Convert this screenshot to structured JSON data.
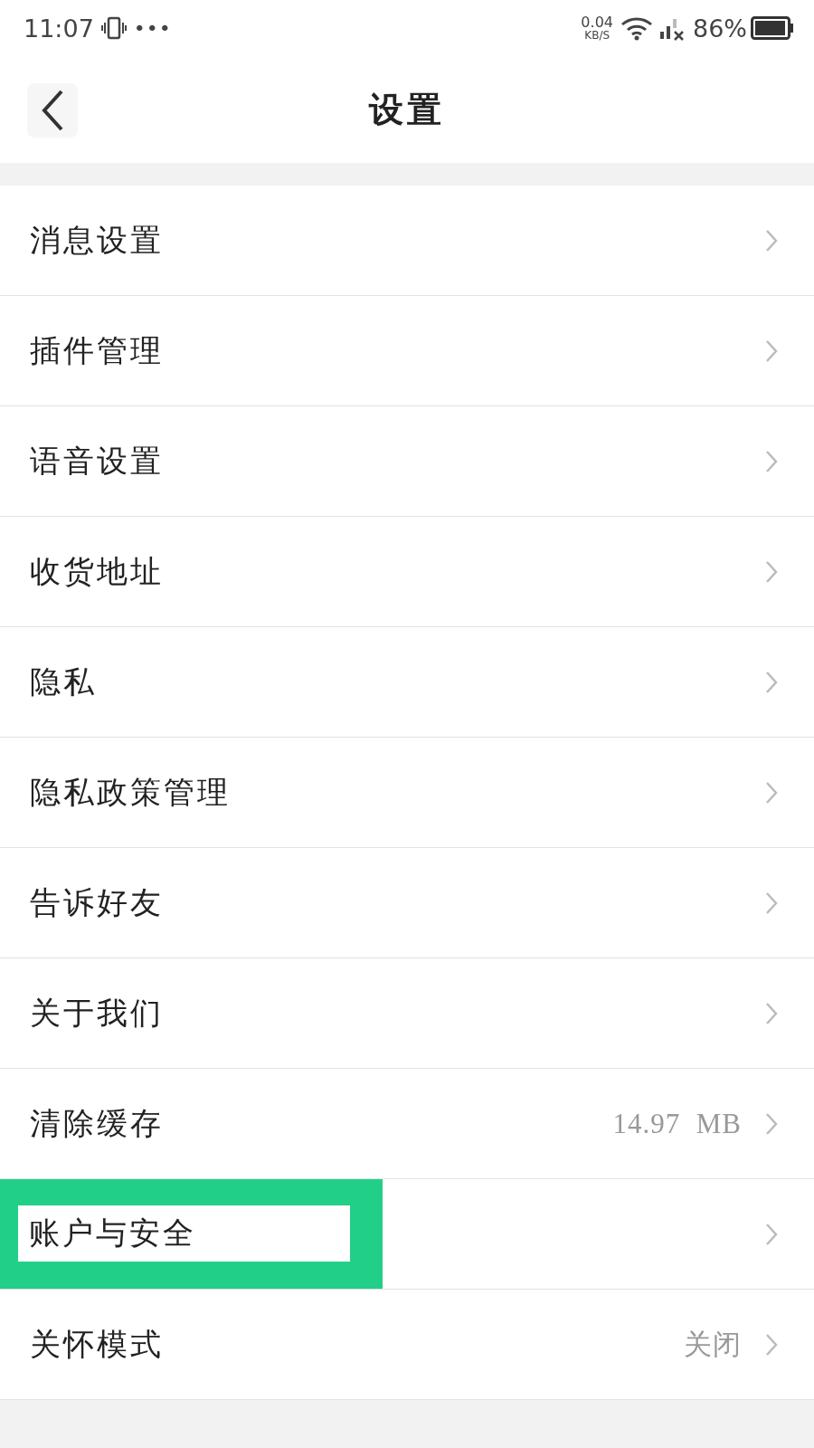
{
  "status_bar": {
    "time": "11:07",
    "more": "•••",
    "speed": "0.04",
    "speed_unit": "KB/S",
    "battery": "86%"
  },
  "header": {
    "title": "设置"
  },
  "items": [
    {
      "label": "消息设置",
      "highlighted": false
    },
    {
      "label": "插件管理",
      "highlighted": false
    },
    {
      "label": "语音设置",
      "highlighted": false
    },
    {
      "label": "收货地址",
      "highlighted": false
    },
    {
      "label": "隐私",
      "highlighted": false
    },
    {
      "label": "隐私政策管理",
      "highlighted": false
    },
    {
      "label": "告诉好友",
      "highlighted": false
    },
    {
      "label": "关于我们",
      "highlighted": false
    },
    {
      "label": "清除缓存",
      "value": "14.97  MB",
      "highlighted": false
    },
    {
      "label": "账户与安全",
      "highlighted": true
    },
    {
      "label": "关怀模式",
      "value": "关闭",
      "highlighted": false
    }
  ]
}
